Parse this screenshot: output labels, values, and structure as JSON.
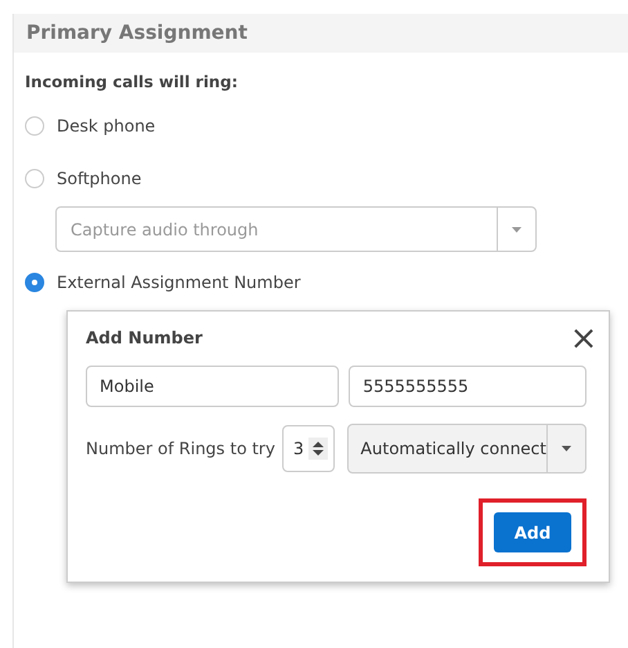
{
  "panel": {
    "title": "Primary Assignment"
  },
  "prompt": "Incoming calls will ring:",
  "options": [
    {
      "label": "Desk phone",
      "selected": false
    },
    {
      "label": "Softphone",
      "selected": false
    },
    {
      "label": "External Assignment Number",
      "selected": true
    }
  ],
  "audio_select": {
    "placeholder": "Capture audio through"
  },
  "dialog": {
    "title": "Add Number",
    "close": "×",
    "name_field": {
      "value": "Mobile"
    },
    "number_field": {
      "value": "5555555555"
    },
    "rings_label": "Number of Rings to try",
    "rings": "3",
    "mode": "Automatically connect",
    "add_button": {
      "label": "Add",
      "highlighted": true
    }
  }
}
